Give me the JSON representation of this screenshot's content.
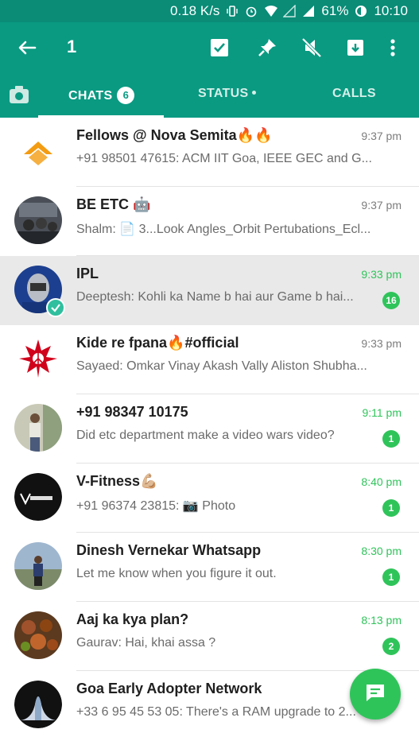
{
  "status_bar": {
    "speed": "0.18 K/s",
    "battery": "61%",
    "time": "10:10"
  },
  "appbar": {
    "selected_count": "1",
    "icons": [
      "back-arrow-icon",
      "select-all-icon",
      "pin-icon",
      "mute-icon",
      "archive-icon",
      "overflow-menu-icon"
    ]
  },
  "tabs": {
    "chats_label": "CHATS",
    "chats_badge": "6",
    "status_label": "STATUS",
    "calls_label": "CALLS"
  },
  "chats": [
    {
      "name": "Fellows @ Nova Semita🔥🔥",
      "message": "+91 98501 47615: ACM IIT Goa, IEEE GEC and G...",
      "time": "9:37 pm",
      "unread": "",
      "time_green": false
    },
    {
      "name": "BE ETC 🤖",
      "message": "Shalm: 📄 3...Look Angles_Orbit Pertubations_Ecl...",
      "time": "9:37 pm",
      "unread": "",
      "time_green": false
    },
    {
      "name": "IPL",
      "message": "Deeptesh: Kohli ka Name b hai aur Game b hai...",
      "time": "9:33 pm",
      "unread": "16",
      "time_green": true
    },
    {
      "name": "Kide re fpana🔥#official",
      "message": "Sayaed: Omkar Vinay Akash  Vally Aliston Shubha...",
      "time": "9:33 pm",
      "unread": "",
      "time_green": false
    },
    {
      "name": "+91 98347 10175",
      "message": "Did etc department make a video wars video?",
      "time": "9:11 pm",
      "unread": "1",
      "time_green": true
    },
    {
      "name": "V-Fitness💪🏼",
      "message": "+91 96374 23815: 📷 Photo",
      "time": "8:40 pm",
      "unread": "1",
      "time_green": true
    },
    {
      "name": "Dinesh Vernekar Whatsapp",
      "message": "Let me know when you figure it out.",
      "time": "8:30 pm",
      "unread": "1",
      "time_green": true
    },
    {
      "name": "Aaj ka kya plan?",
      "message": "Gaurav: Hai, khai assa ?",
      "time": "8:13 pm",
      "unread": "2",
      "time_green": true
    },
    {
      "name": "Goa Early Adopter Network",
      "message": "+33 6 95 45 53 05: There's a RAM upgrade to 2...",
      "time": "",
      "unread": "",
      "time_green": false
    }
  ],
  "colors": {
    "primary": "#0a9a82",
    "status_bar": "#0a8c77",
    "accent": "#2fc45a"
  }
}
